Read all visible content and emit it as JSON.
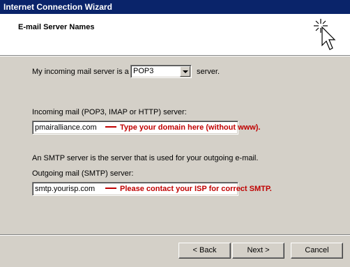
{
  "window": {
    "title": "Internet Connection Wizard"
  },
  "header": {
    "title": "E-mail Server Names",
    "icon": "wizard-cursor-icon"
  },
  "incoming_server_type": {
    "label_prefix": "My incoming mail server is a",
    "selected": "POP3",
    "label_suffix": "server."
  },
  "incoming": {
    "label": "Incoming mail (POP3, IMAP or HTTP) server:",
    "value": "pmairalliance.com",
    "note": "Type your domain here (without www)."
  },
  "smtp_info": "An SMTP server is the server that is used for your outgoing e-mail.",
  "outgoing": {
    "label": "Outgoing mail (SMTP) server:",
    "value": "smtp.yourisp.com",
    "note": "Please contact your ISP for correct SMTP."
  },
  "buttons": {
    "back": "< Back",
    "next": "Next >",
    "cancel": "Cancel"
  },
  "colors": {
    "titlebar": "#0a246a",
    "dialog": "#d4d0c8",
    "note": "#c00000"
  }
}
